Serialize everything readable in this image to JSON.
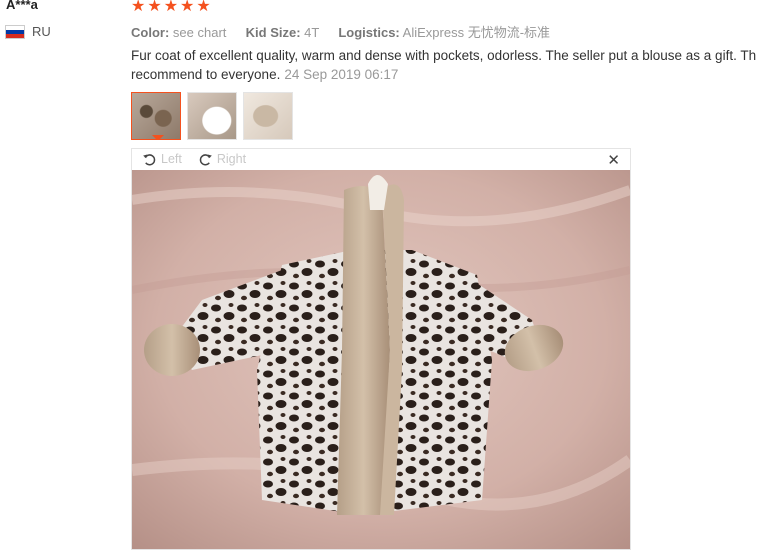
{
  "user": {
    "name": "A***a",
    "country_code": "RU"
  },
  "rating": {
    "stars": 5,
    "star_glyph": "★",
    "color": "#f4511e"
  },
  "attributes": [
    {
      "label": "Color:",
      "value": "see chart"
    },
    {
      "label": "Kid Size:",
      "value": "4T"
    },
    {
      "label": "Logistics:",
      "value": "AliExpress 无忧物流-标准"
    }
  ],
  "review": {
    "text": "Fur coat of excellent quality, warm and dense with pockets, odorless. The seller put a blouse as a gift. Th recommend to everyone.",
    "line1": "Fur coat of excellent quality, warm and dense with pockets, odorless. The seller put a blouse as a gift. Th",
    "line2": "recommend to everyone.",
    "date": "24 Sep 2019 06:17"
  },
  "thumbnails": [
    {
      "name": "thumbnail-1",
      "active": true
    },
    {
      "name": "thumbnail-2",
      "active": false
    },
    {
      "name": "thumbnail-3",
      "active": false
    }
  ],
  "viewer": {
    "rotate_left_label": "Left",
    "rotate_right_label": "Right",
    "close_glyph": "✕",
    "icons": [
      "rotate-left-icon",
      "rotate-right-icon",
      "close-icon"
    ]
  },
  "colors": {
    "accent": "#f4511e",
    "muted_text": "#999999",
    "border": "#e4e4e4"
  }
}
